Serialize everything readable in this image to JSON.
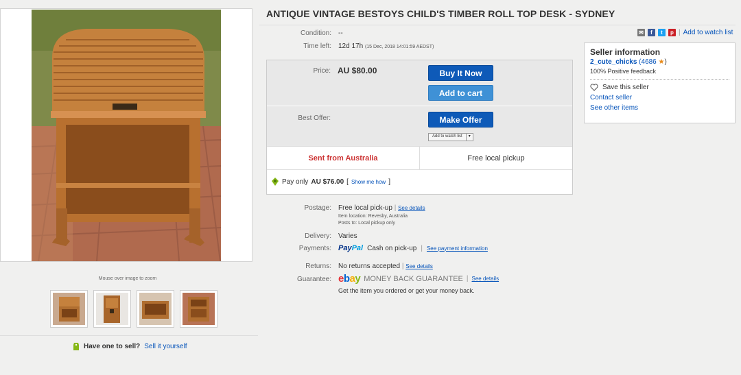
{
  "listing": {
    "title": "ANTIQUE VINTAGE BESTOYS CHILD'S TIMBER ROLL TOP DESK - SYDNEY",
    "condition_label": "Condition:",
    "condition_value": "--",
    "time_left_label": "Time left:",
    "time_left_value": "12d 17h",
    "time_left_detail": "(15 Dec, 2018   14:01:59 AEDST)"
  },
  "gallery": {
    "zoom_hint": "Mouse over image to zoom",
    "sell_prompt": "Have one to sell?",
    "sell_link": "Sell it yourself"
  },
  "buybox": {
    "price_label": "Price:",
    "price_value": "AU $80.00",
    "buy_now": "Buy It Now",
    "add_to_cart": "Add to cart",
    "best_offer_label": "Best Offer:",
    "make_offer": "Make Offer",
    "add_to_watch": "Add to watch list",
    "sent_from": "Sent from Australia",
    "free_pickup": "Free local pickup",
    "pay_only_prefix": "Pay only",
    "pay_only_amount": "AU $76.00",
    "show_me_how": "Show me how"
  },
  "details": {
    "postage_label": "Postage:",
    "postage_value": "Free local pick-up",
    "postage_link": "See details",
    "item_location": "Item location:   Revesby, Australia",
    "posts_to": "Posts to:   Local pickup only",
    "delivery_label": "Delivery:",
    "delivery_value": "Varies",
    "payments_label": "Payments:",
    "paypal": "PayPal",
    "cash": "Cash on pick-up",
    "payment_link": "See payment information",
    "returns_label": "Returns:",
    "returns_value": "No returns accepted",
    "returns_link": "See details",
    "guarantee_label": "Guarantee:",
    "ebay_e": "e",
    "ebay_b": "b",
    "ebay_a": "a",
    "ebay_y": "y",
    "guarantee_text": "MONEY BACK GUARANTEE",
    "guarantee_link": "See details",
    "guarantee_note": "Get the item you ordered or get your money back."
  },
  "share": {
    "watch_link": "Add to watch list"
  },
  "seller": {
    "heading": "Seller information",
    "name": "2_cute_chicks",
    "score": "(4686",
    "score_close": ")",
    "feedback": "100% Positive feedback",
    "save": "Save this seller",
    "contact": "Contact seller",
    "other": "See other items"
  },
  "colors": {
    "ebay_red": "#e53238",
    "ebay_blue": "#0064d2",
    "ebay_yellow": "#f5af02",
    "ebay_green": "#86b817",
    "button_blue": "#0e5ab8"
  }
}
